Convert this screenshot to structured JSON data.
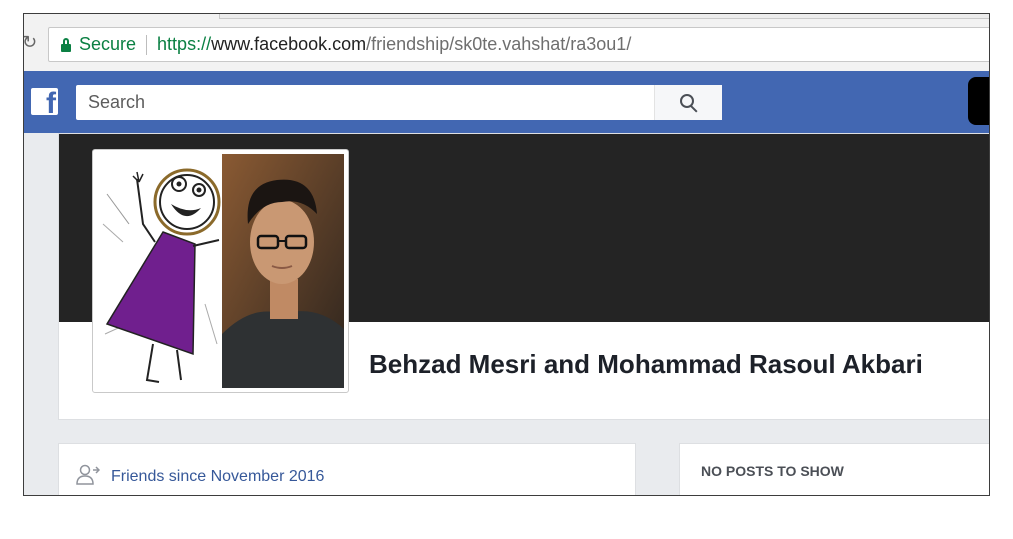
{
  "browser": {
    "secure_label": "Secure",
    "url_scheme": "https://",
    "url_host": "www.facebook.com",
    "url_path": "/friendship/sk0te.vahshat/ra3ou1/"
  },
  "facebook_bar": {
    "logo_letter": "f",
    "search_placeholder": "Search"
  },
  "friendship": {
    "names": "Behzad Mesri and Mohammad Rasoul Akbari",
    "friends_since": "Friends since November 2016",
    "posts_header": "NO POSTS TO SHOW"
  },
  "colors": {
    "facebook_blue": "#4267b2",
    "secure_green": "#0b8043",
    "link_blue": "#365899",
    "cover_dark": "#242424"
  }
}
